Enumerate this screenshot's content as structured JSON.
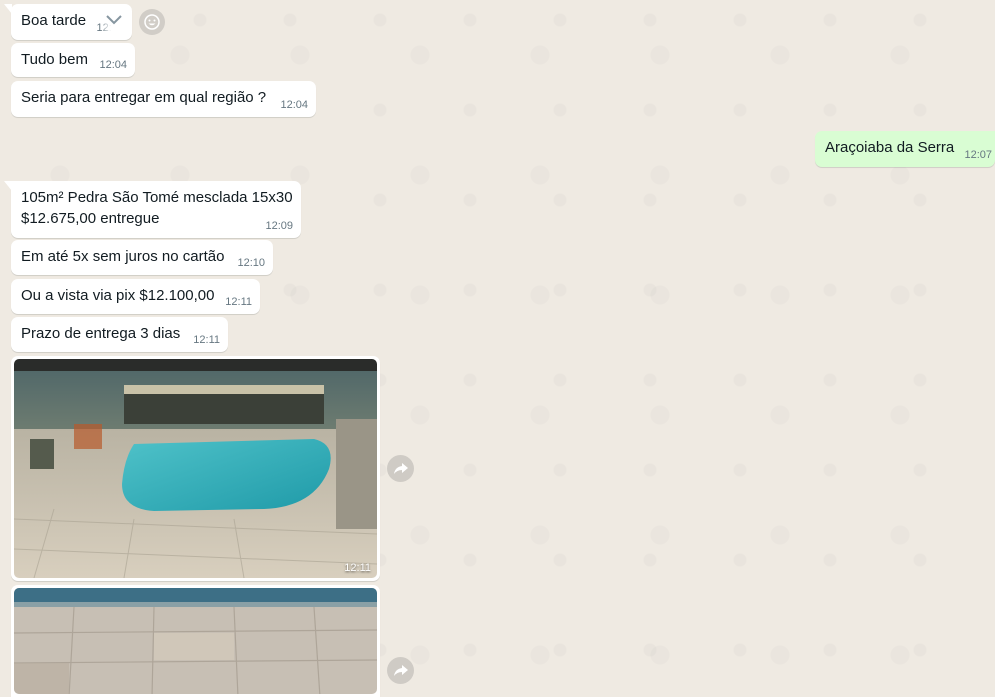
{
  "messages": [
    {
      "text": "Boa tarde",
      "time": "12:04",
      "direction": "in"
    },
    {
      "text": "Tudo bem",
      "time": "12:04",
      "direction": "in"
    },
    {
      "text": "Seria para entregar em qual região ?",
      "time": "12:04",
      "direction": "in"
    },
    {
      "text": "Araçoiaba da Serra",
      "time": "12:07",
      "direction": "out"
    },
    {
      "text": "105m² Pedra São Tomé mesclada 15x30\n$12.675,00 entregue",
      "time": "12:09",
      "direction": "in"
    },
    {
      "text": "Em até 5x sem juros no cartão",
      "time": "12:10",
      "direction": "in"
    },
    {
      "text": "Ou a vista via pix $12.100,00",
      "time": "12:11",
      "direction": "in"
    },
    {
      "text": "Prazo de entrega 3 dias",
      "time": "12:11",
      "direction": "in"
    }
  ],
  "media": [
    {
      "kind": "image",
      "subject": "pool with stone deck",
      "time": "12:11"
    },
    {
      "kind": "image",
      "subject": "stone pavers by pool edge",
      "time": ""
    }
  ],
  "icons": {
    "menu": "chevron-down-icon",
    "emoji": "emoji-icon",
    "forward": "forward-icon"
  },
  "colors": {
    "background": "#efeae2",
    "incoming_bubble": "#ffffff",
    "outgoing_bubble": "#d9fdd3",
    "timestamp": "#667781"
  }
}
